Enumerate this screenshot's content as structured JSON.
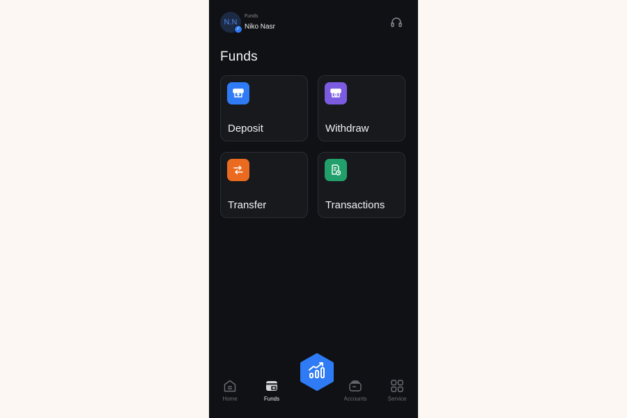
{
  "header": {
    "avatar_initials": "N.N",
    "subtitle": "Funds",
    "user_name": "Niko Nasr"
  },
  "page": {
    "title": "Funds"
  },
  "actions": [
    {
      "label": "Deposit",
      "color": "#2f7bf5",
      "icon": "deposit-icon"
    },
    {
      "label": "Withdraw",
      "color": "#7b5ce0",
      "icon": "withdraw-icon"
    },
    {
      "label": "Transfer",
      "color": "#ea6b1f",
      "icon": "transfer-icon"
    },
    {
      "label": "Transactions",
      "color": "#22a06b",
      "icon": "transactions-icon"
    }
  ],
  "bottom_nav": {
    "items": [
      {
        "label": "Home",
        "icon": "home-icon",
        "active": false
      },
      {
        "label": "Funds",
        "icon": "funds-icon",
        "active": true
      },
      {
        "label": "Accounts",
        "icon": "accounts-icon",
        "active": false
      },
      {
        "label": "Service",
        "icon": "grid-icon",
        "active": false
      }
    ],
    "center_button_icon": "chart-icon",
    "center_button_color": "#2f7bf5"
  }
}
